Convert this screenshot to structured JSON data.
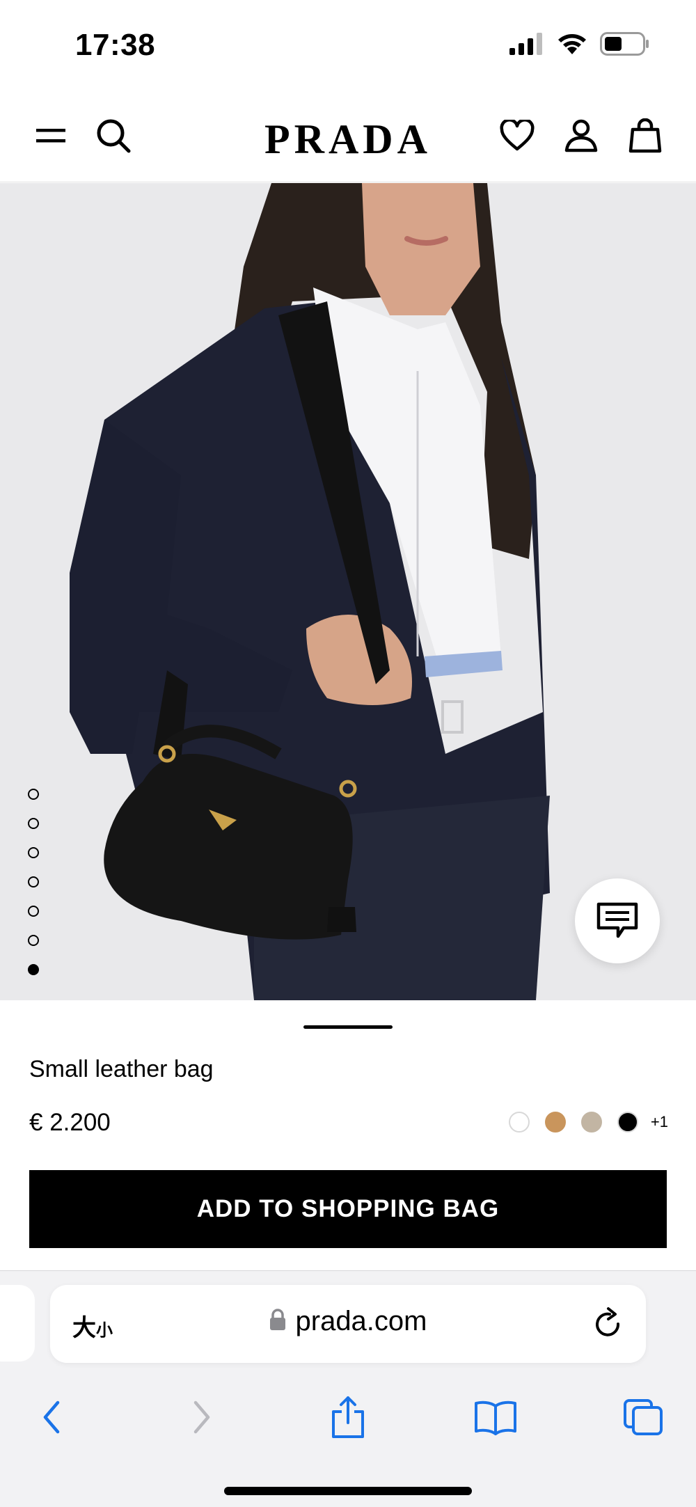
{
  "status": {
    "time": "17:38"
  },
  "header": {
    "brand": "PRADA",
    "icons": [
      "menu-icon",
      "search-icon",
      "heart-icon",
      "account-icon",
      "shopping-bag-icon"
    ]
  },
  "hero": {
    "image_count": 7,
    "active_index": 6,
    "chat_icon": "chat-icon"
  },
  "product": {
    "name": "Small leather bag",
    "price": "€ 2.200",
    "swatches": [
      "#ffffff",
      "#c9955c",
      "#c2b5a3",
      "#000000"
    ],
    "more_colors": "+1",
    "add_button": "ADD TO SHOPPING BAG"
  },
  "browser": {
    "text_size": "大",
    "text_size_small": "小",
    "url": "prada.com",
    "toolbar": [
      "back-icon",
      "forward-icon",
      "share-icon",
      "bookmarks-icon",
      "tabs-icon"
    ],
    "accent": "#1a73e8"
  }
}
